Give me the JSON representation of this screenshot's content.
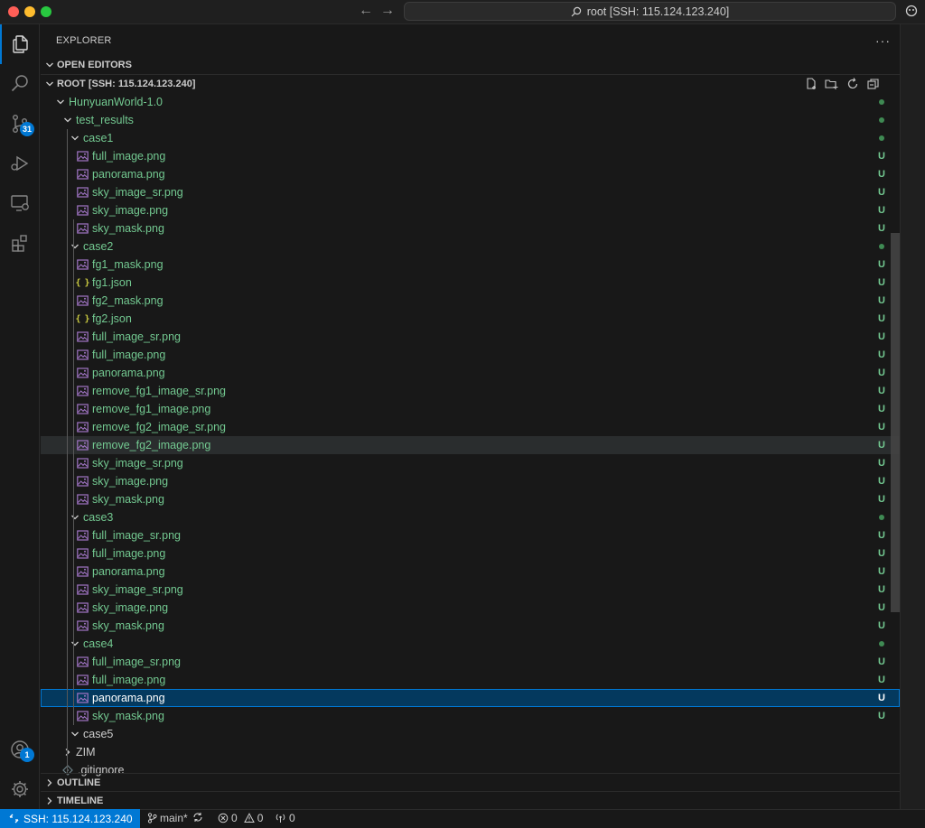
{
  "window": {
    "command_center": "root [SSH: 115.124.123.240]"
  },
  "activity_bar": {
    "source_control_badge": "31",
    "accounts_badge": "1"
  },
  "explorer": {
    "title": "EXPLORER",
    "more_actions": "···",
    "open_editors": "OPEN EDITORS",
    "root": "ROOT [SSH: 115.124.123.240]",
    "outline": "OUTLINE",
    "timeline": "TIMELINE"
  },
  "tree": [
    {
      "label": "HunyuanWorld-1.0",
      "type": "folder",
      "depth": 0,
      "expanded": true,
      "status": "dot"
    },
    {
      "label": "test_results",
      "type": "folder",
      "depth": 1,
      "expanded": true,
      "status": "dot"
    },
    {
      "label": "case1",
      "type": "folder",
      "depth": 2,
      "expanded": true,
      "status": "dot"
    },
    {
      "label": "full_image.png",
      "type": "image",
      "depth": 3,
      "status": "U"
    },
    {
      "label": "panorama.png",
      "type": "image",
      "depth": 3,
      "status": "U"
    },
    {
      "label": "sky_image_sr.png",
      "type": "image",
      "depth": 3,
      "status": "U"
    },
    {
      "label": "sky_image.png",
      "type": "image",
      "depth": 3,
      "status": "U"
    },
    {
      "label": "sky_mask.png",
      "type": "image",
      "depth": 3,
      "status": "U"
    },
    {
      "label": "case2",
      "type": "folder",
      "depth": 2,
      "expanded": true,
      "status": "dot"
    },
    {
      "label": "fg1_mask.png",
      "type": "image",
      "depth": 3,
      "status": "U"
    },
    {
      "label": "fg1.json",
      "type": "json",
      "depth": 3,
      "status": "U"
    },
    {
      "label": "fg2_mask.png",
      "type": "image",
      "depth": 3,
      "status": "U"
    },
    {
      "label": "fg2.json",
      "type": "json",
      "depth": 3,
      "status": "U"
    },
    {
      "label": "full_image_sr.png",
      "type": "image",
      "depth": 3,
      "status": "U"
    },
    {
      "label": "full_image.png",
      "type": "image",
      "depth": 3,
      "status": "U"
    },
    {
      "label": "panorama.png",
      "type": "image",
      "depth": 3,
      "status": "U"
    },
    {
      "label": "remove_fg1_image_sr.png",
      "type": "image",
      "depth": 3,
      "status": "U"
    },
    {
      "label": "remove_fg1_image.png",
      "type": "image",
      "depth": 3,
      "status": "U"
    },
    {
      "label": "remove_fg2_image_sr.png",
      "type": "image",
      "depth": 3,
      "status": "U"
    },
    {
      "label": "remove_fg2_image.png",
      "type": "image",
      "depth": 3,
      "status": "U",
      "hover": true
    },
    {
      "label": "sky_image_sr.png",
      "type": "image",
      "depth": 3,
      "status": "U"
    },
    {
      "label": "sky_image.png",
      "type": "image",
      "depth": 3,
      "status": "U"
    },
    {
      "label": "sky_mask.png",
      "type": "image",
      "depth": 3,
      "status": "U"
    },
    {
      "label": "case3",
      "type": "folder",
      "depth": 2,
      "expanded": true,
      "status": "dot"
    },
    {
      "label": "full_image_sr.png",
      "type": "image",
      "depth": 3,
      "status": "U"
    },
    {
      "label": "full_image.png",
      "type": "image",
      "depth": 3,
      "status": "U"
    },
    {
      "label": "panorama.png",
      "type": "image",
      "depth": 3,
      "status": "U"
    },
    {
      "label": "sky_image_sr.png",
      "type": "image",
      "depth": 3,
      "status": "U"
    },
    {
      "label": "sky_image.png",
      "type": "image",
      "depth": 3,
      "status": "U"
    },
    {
      "label": "sky_mask.png",
      "type": "image",
      "depth": 3,
      "status": "U"
    },
    {
      "label": "case4",
      "type": "folder",
      "depth": 2,
      "expanded": true,
      "status": "dot"
    },
    {
      "label": "full_image_sr.png",
      "type": "image",
      "depth": 3,
      "status": "U"
    },
    {
      "label": "full_image.png",
      "type": "image",
      "depth": 3,
      "status": "U"
    },
    {
      "label": "panorama.png",
      "type": "image",
      "depth": 3,
      "status": "U",
      "selected": true
    },
    {
      "label": "sky_mask.png",
      "type": "image",
      "depth": 3,
      "status": "U"
    },
    {
      "label": "case5",
      "type": "folder",
      "depth": 2,
      "expanded": true,
      "status": ""
    },
    {
      "label": "ZIM",
      "type": "folder",
      "depth": 1,
      "expanded": false,
      "status": ""
    },
    {
      "label": ".gitignore",
      "type": "gitignore",
      "depth": 1,
      "status": ""
    }
  ],
  "status_bar": {
    "remote": "SSH: 115.124.123.240",
    "branch": "main*",
    "errors": "0",
    "warnings": "0",
    "ports": "0"
  },
  "colors": {
    "accent": "#0078d4",
    "git_untracked": "#73c991",
    "selection": "#04395e"
  }
}
